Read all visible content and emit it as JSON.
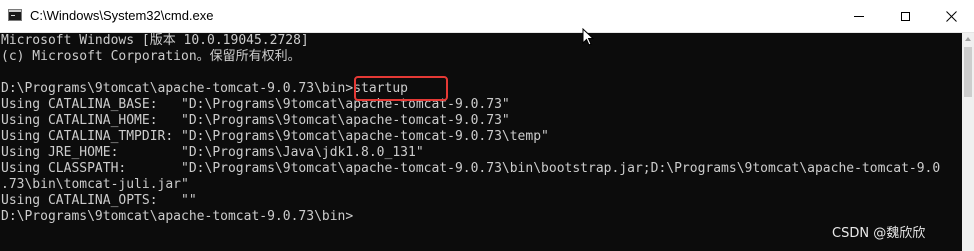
{
  "window": {
    "title": "C:\\Windows\\System32\\cmd.exe"
  },
  "console": {
    "lines": [
      "Microsoft Windows [版本 10.0.19045.2728]",
      "(c) Microsoft Corporation。保留所有权利。",
      "",
      "D:\\Programs\\9tomcat\\apache-tomcat-9.0.73\\bin>startup",
      "Using CATALINA_BASE:   \"D:\\Programs\\9tomcat\\apache-tomcat-9.0.73\"",
      "Using CATALINA_HOME:   \"D:\\Programs\\9tomcat\\apache-tomcat-9.0.73\"",
      "Using CATALINA_TMPDIR: \"D:\\Programs\\9tomcat\\apache-tomcat-9.0.73\\temp\"",
      "Using JRE_HOME:        \"D:\\Programs\\Java\\jdk1.8.0_131\"",
      "Using CLASSPATH:       \"D:\\Programs\\9tomcat\\apache-tomcat-9.0.73\\bin\\bootstrap.jar;D:\\Programs\\9tomcat\\apache-tomcat-9.0",
      ".73\\bin\\tomcat-juli.jar\"",
      "Using CATALINA_OPTS:   \"\"",
      "D:\\Programs\\9tomcat\\apache-tomcat-9.0.73\\bin>"
    ]
  },
  "watermark": "CSDN @魏欣欣",
  "colors": {
    "console_bg": "#0c0c0c",
    "console_text": "#cccccc",
    "highlight_border": "#e53935"
  }
}
